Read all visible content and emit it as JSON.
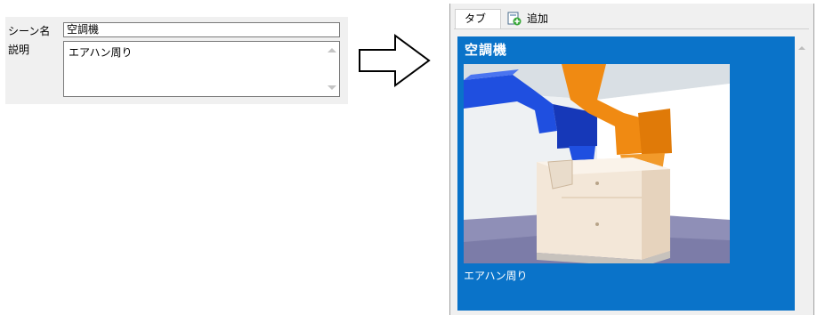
{
  "form": {
    "name_label": "シーン名",
    "name_value": "空調機",
    "description_label": "説明",
    "description_value": "エアハン周り"
  },
  "tabs": {
    "active_label": "タブ",
    "add_label": "追加"
  },
  "scene": {
    "title": "空調機",
    "description": "エアハン周り"
  },
  "icons": {
    "scroll_up": "chevron-up-icon",
    "scroll_down": "chevron-down-icon",
    "add": "add-page-icon",
    "arrow": "right-arrow-icon"
  },
  "colors": {
    "panel_background": "#0a73c9",
    "duct_blue": "#1f4fe0",
    "duct_orange": "#f08a12"
  }
}
